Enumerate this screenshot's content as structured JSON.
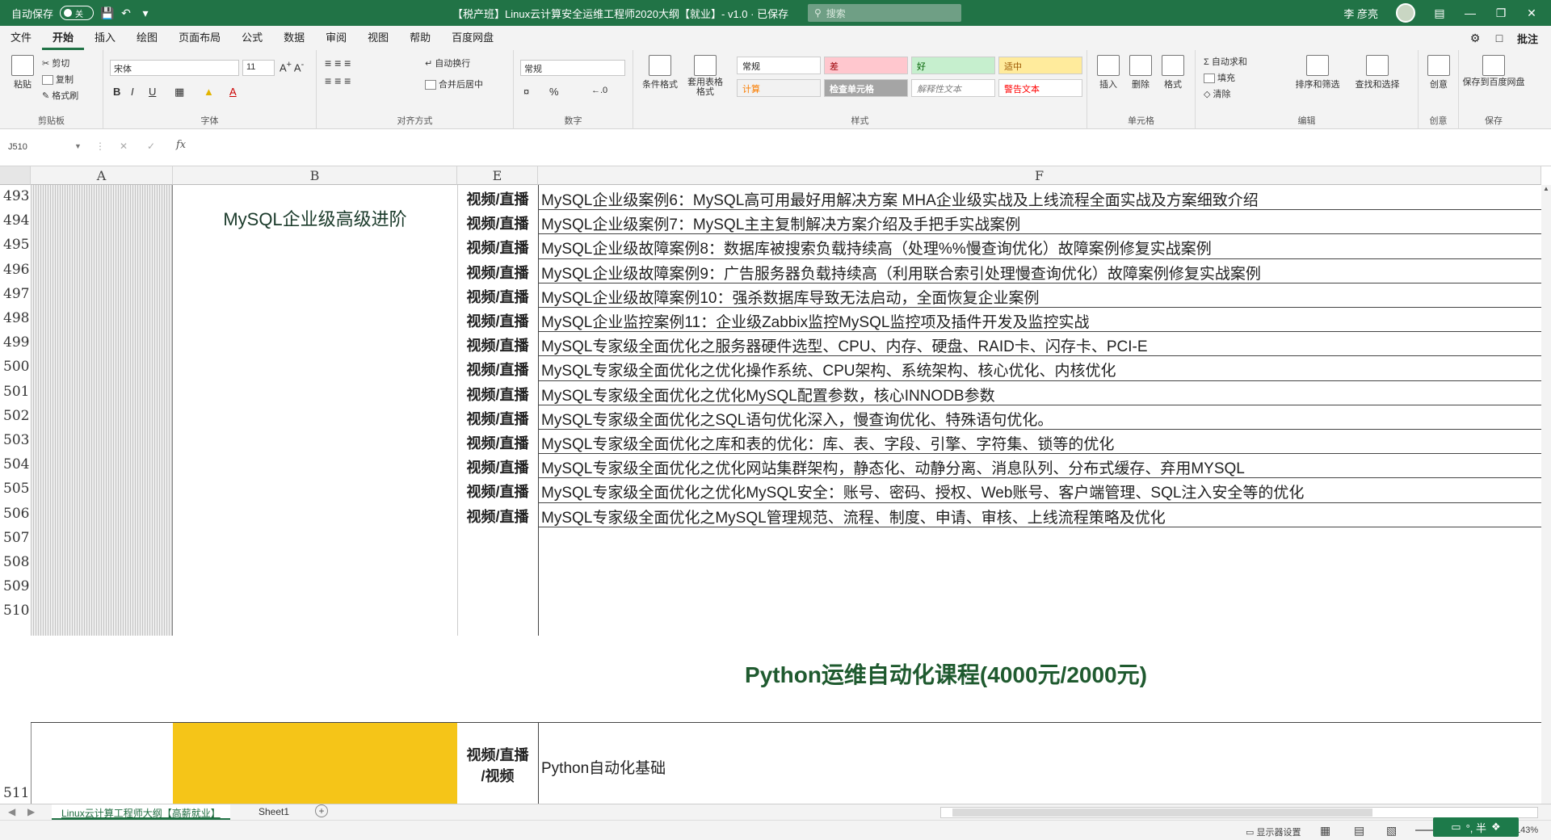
{
  "titlebar": {
    "autosave_label": "自动保存",
    "autosave_state": "关",
    "title": "【税产班】Linux云计算安全运维工程师2020大纲【就业】- v1.0  ·  已保存",
    "search_placeholder": "搜索",
    "user_name": "李 彦亮"
  },
  "tabs": {
    "items": [
      "文件",
      "开始",
      "插入",
      "绘图",
      "页面布局",
      "公式",
      "数据",
      "审阅",
      "视图",
      "帮助",
      "百度网盘"
    ],
    "active": "开始",
    "comment_label": "批注"
  },
  "ribbon": {
    "clipboard": {
      "paste": "粘贴",
      "cut": "剪切",
      "copy": "复制",
      "format_painter": "格式刷",
      "label": "剪贴板"
    },
    "font": {
      "name": "宋体",
      "size": "11",
      "bold": "B",
      "italic": "I",
      "underline": "U",
      "label": "字体"
    },
    "alignment": {
      "wrap": "自动换行",
      "merge": "合并后居中",
      "label": "对齐方式"
    },
    "number": {
      "format": "常规",
      "percent": "%",
      "label": "数字"
    },
    "styles": {
      "conditional": "条件格式",
      "table": "套用表格格式",
      "cells": [
        "常规",
        "差",
        "好",
        "适中",
        "计算",
        "检查单元格",
        "解释性文本",
        "警告文本"
      ],
      "label": "样式"
    },
    "cells_group": {
      "insert": "插入",
      "delete": "删除",
      "format": "格式",
      "label": "单元格"
    },
    "editing": {
      "autosum": "自动求和",
      "fill": "填充",
      "clear": "清除",
      "sort": "排序和筛选",
      "find": "查找和选择",
      "label": "编辑"
    },
    "ideas": {
      "label": "创意",
      "button": "创意"
    },
    "save": {
      "button": "保存到百度网盘",
      "label": "保存"
    }
  },
  "formula_bar": {
    "name_box": "J510",
    "fx": "fx",
    "content": ""
  },
  "columns": [
    "A",
    "B",
    "E",
    "F"
  ],
  "rows": [
    {
      "num": "493",
      "e": "视频/直播",
      "f": "MySQL企业级案例6：MySQL高可用最好用解决方案 MHA企业级实战及上线流程全面实战及方案细致介绍"
    },
    {
      "num": "494",
      "e": "视频/直播",
      "f": "MySQL企业级案例7：MySQL主主复制解决方案介绍及手把手实战案例"
    },
    {
      "num": "495",
      "e": "视频/直播",
      "f": "MySQL企业级故障案例8：数据库被搜索负载持续高（处理%%慢查询优化）故障案例修复实战案例"
    },
    {
      "num": "496",
      "e": "视频/直播",
      "f": "MySQL企业级故障案例9：广告服务器负载持续高（利用联合索引处理慢查询优化）故障案例修复实战案例"
    },
    {
      "num": "497",
      "e": "视频/直播",
      "f": "MySQL企业级故障案例10：强杀数据库导致无法启动，全面恢复企业案例"
    },
    {
      "num": "498",
      "e": "视频/直播",
      "f": "MySQL企业监控案例11：企业级Zabbix监控MySQL监控项及插件开发及监控实战"
    },
    {
      "num": "499",
      "e": "视频/直播",
      "f": "MySQL专家级全面优化之服务器硬件选型、CPU、内存、硬盘、RAID卡、闪存卡、PCI-E"
    },
    {
      "num": "500",
      "e": "视频/直播",
      "f": "MySQL专家级全面优化之优化操作系统、CPU架构、系统架构、核心优化、内核优化"
    },
    {
      "num": "501",
      "e": "视频/直播",
      "f": "MySQL专家级全面优化之优化MySQL配置参数，核心INNODB参数"
    },
    {
      "num": "502",
      "e": "视频/直播",
      "f": "MySQL专家级全面优化之SQL语句优化深入，慢查询优化、特殊语句优化。"
    },
    {
      "num": "503",
      "e": "视频/直播",
      "f": "MySQL专家级全面优化之库和表的优化：库、表、字段、引擎、字符集、锁等的优化"
    },
    {
      "num": "504",
      "e": "视频/直播",
      "f": "MySQL专家级全面优化之优化网站集群架构，静态化、动静分离、消息队列、分布式缓存、弃用MYSQL"
    },
    {
      "num": "505",
      "e": "视频/直播",
      "f": "MySQL专家级全面优化之优化MySQL安全：账号、密码、授权、Web账号、客户端管理、SQL注入安全等的优化"
    },
    {
      "num": "506",
      "e": "视频/直播",
      "f": "MySQL专家级全面优化之MySQL管理规范、流程、制度、申请、审核、上线流程策略及优化"
    },
    {
      "num": "507",
      "e": "",
      "f": ""
    },
    {
      "num": "508",
      "e": "",
      "f": ""
    },
    {
      "num": "509",
      "e": "",
      "f": ""
    },
    {
      "num": "510",
      "e": "",
      "f": ""
    }
  ],
  "section_b_label": "MySQL企业级高级进阶",
  "python_heading": "Python运维自动化课程(4000元/2000元)",
  "row511": {
    "num": "511",
    "e_line1": "视频/直播",
    "e_line2": "/视频",
    "f": "Python自动化基础"
  },
  "sheets": {
    "items": [
      "Linux云计算工程师大纲【高薪就业】",
      "Sheet1"
    ],
    "active": "Linux云计算工程师大纲【高薪就业】"
  },
  "status": {
    "display_settings": "显示器设置",
    "zoom": "143%",
    "ime": "°, 半"
  },
  "colors": {
    "title_green": "#217346",
    "highlight_yellow": "#f5c518",
    "heading_green": "#1f5a2f"
  }
}
